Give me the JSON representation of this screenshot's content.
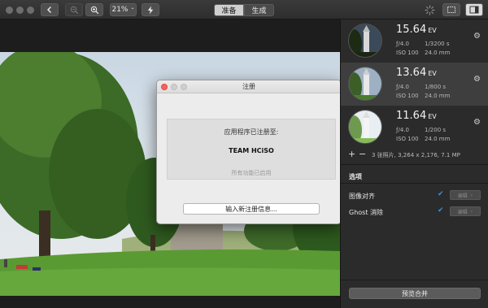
{
  "toolbar": {
    "zoom_value": "21%",
    "tab_prepare": "准备",
    "tab_generate": "生成"
  },
  "dialog": {
    "title": "注册",
    "registered_to": "应用程序已注册至:",
    "licensee": "TEAM HCiSO",
    "features": "所有功能已启用",
    "new_info_button": "输入新注册信息..."
  },
  "brackets": [
    {
      "ev": "15.64",
      "ev_unit": "EV",
      "aperture": "ƒ/4.0",
      "shutter": "1/3200 s",
      "iso": "ISO 100",
      "focal": "24.0 mm"
    },
    {
      "ev": "13.64",
      "ev_unit": "EV",
      "aperture": "ƒ/4.0",
      "shutter": "1/800 s",
      "iso": "ISO 100",
      "focal": "24.0 mm"
    },
    {
      "ev": "11.64",
      "ev_unit": "EV",
      "aperture": "ƒ/4.0",
      "shutter": "1/200 s",
      "iso": "ISO 100",
      "focal": "24.0 mm"
    }
  ],
  "panel": {
    "add_symbol": "+",
    "remove_symbol": "−",
    "summary": "3 张照片, 3,264 x 2,176, 7.1 MP",
    "options_header": "选项",
    "align_label": "图像对齐",
    "ghost_label": "Ghost 消除",
    "edit_label": "编辑",
    "merge_button": "预览合并"
  },
  "colors": {
    "accent": "#3a8ee6",
    "close": "#fc605c",
    "minimize": "#fdbc40",
    "zoom": "#34c84a"
  },
  "icons": [
    "back-arrow-icon",
    "zoom-out-icon",
    "zoom-in-icon",
    "lightning-icon",
    "selection-icon",
    "sidebar-icon",
    "gear-icon",
    "checkmark-icon"
  ]
}
